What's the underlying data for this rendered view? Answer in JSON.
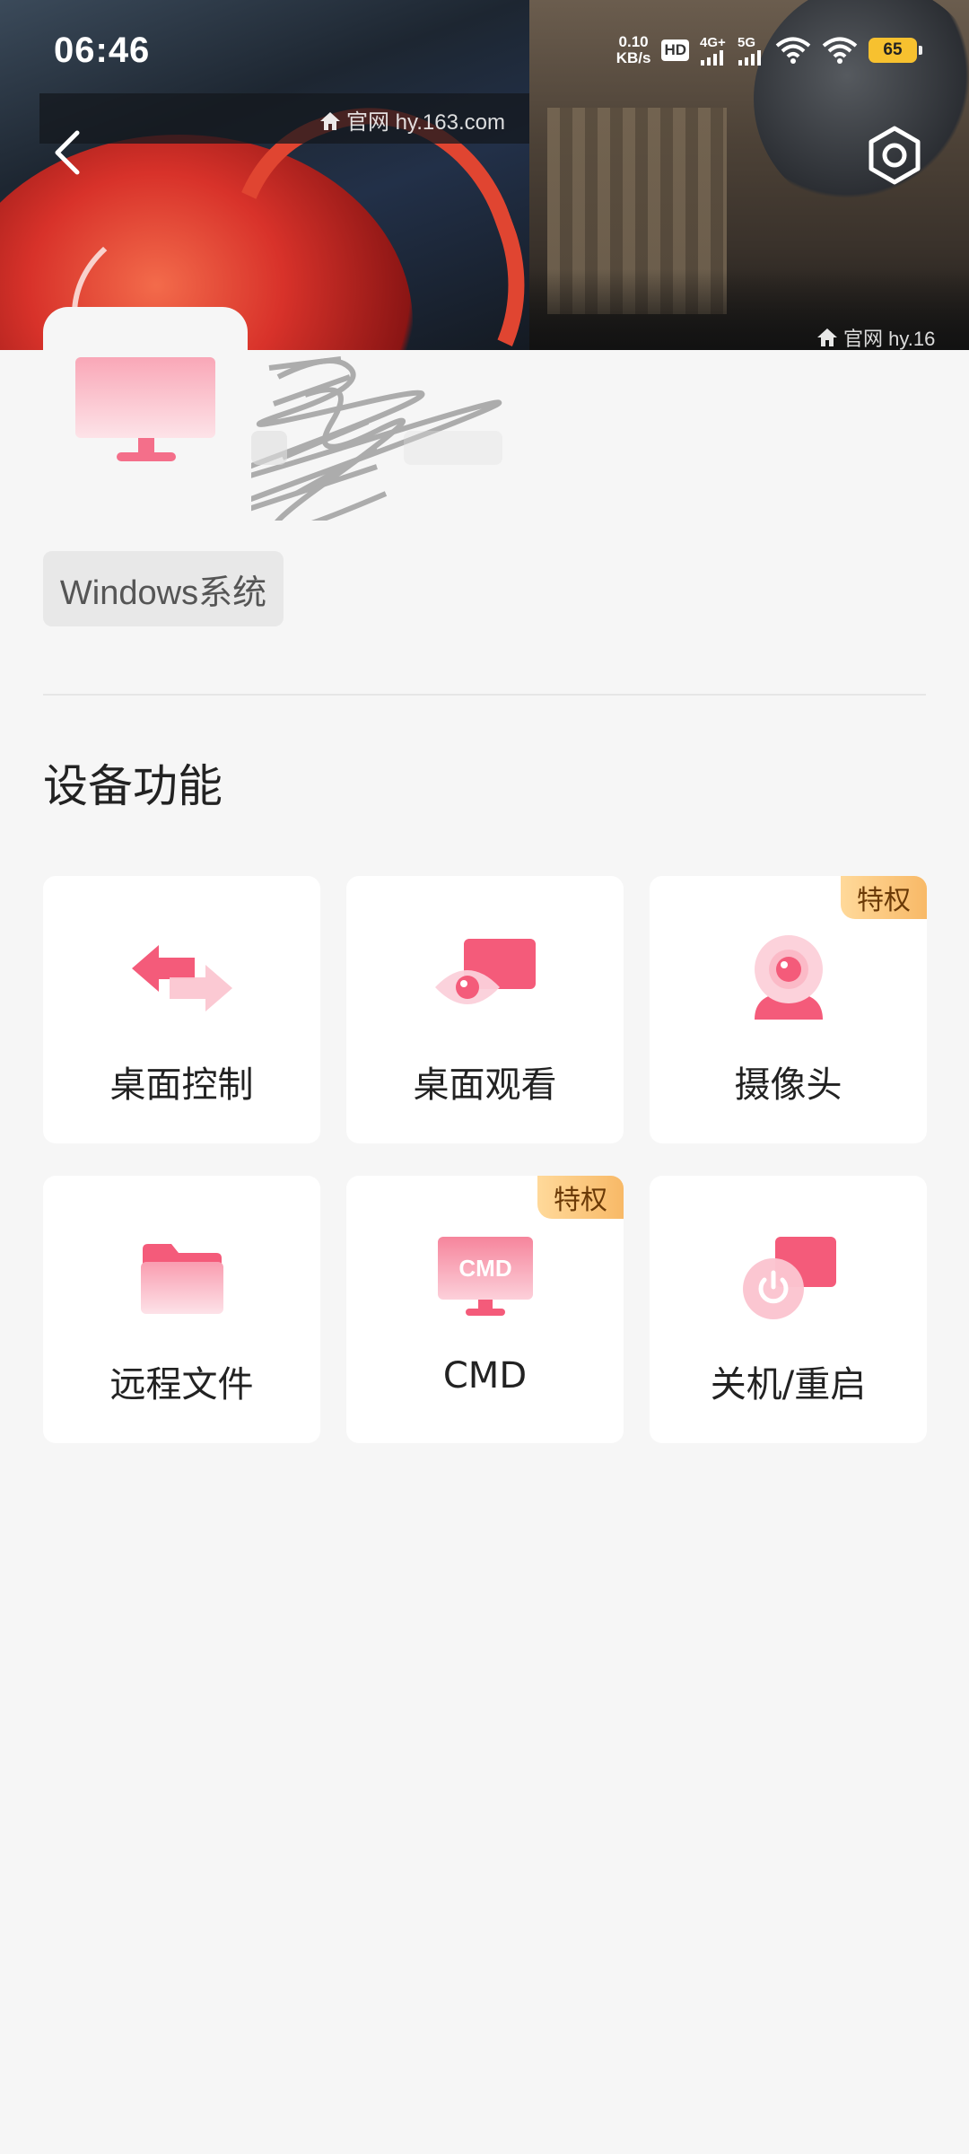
{
  "status_bar": {
    "time": "06:46",
    "net_speed_value": "0.10",
    "net_speed_unit": "KB/s",
    "hd_label": "HD",
    "signal1_label": "4G+",
    "signal2_label": "5G",
    "battery": "65"
  },
  "header": {
    "watermark_1": "官网 hy.163.com",
    "watermark_2": "官网 hy.16"
  },
  "device": {
    "os_tag": "Windows系统"
  },
  "section": {
    "title": "设备功能"
  },
  "functions": [
    {
      "label": "桌面控制",
      "badge": "",
      "icon": "desktop-control-icon"
    },
    {
      "label": "桌面观看",
      "badge": "",
      "icon": "desktop-view-icon"
    },
    {
      "label": "摄像头",
      "badge": "特权",
      "icon": "camera-icon"
    },
    {
      "label": "远程文件",
      "badge": "",
      "icon": "folder-icon"
    },
    {
      "label": "CMD",
      "badge": "特权",
      "icon": "cmd-icon"
    },
    {
      "label": "关机/重启",
      "badge": "",
      "icon": "power-icon"
    }
  ],
  "cmd_icon_text": "CMD",
  "colors": {
    "accent": "#f45b7a",
    "badge": "#f8b967",
    "background": "#f6f6f6"
  }
}
